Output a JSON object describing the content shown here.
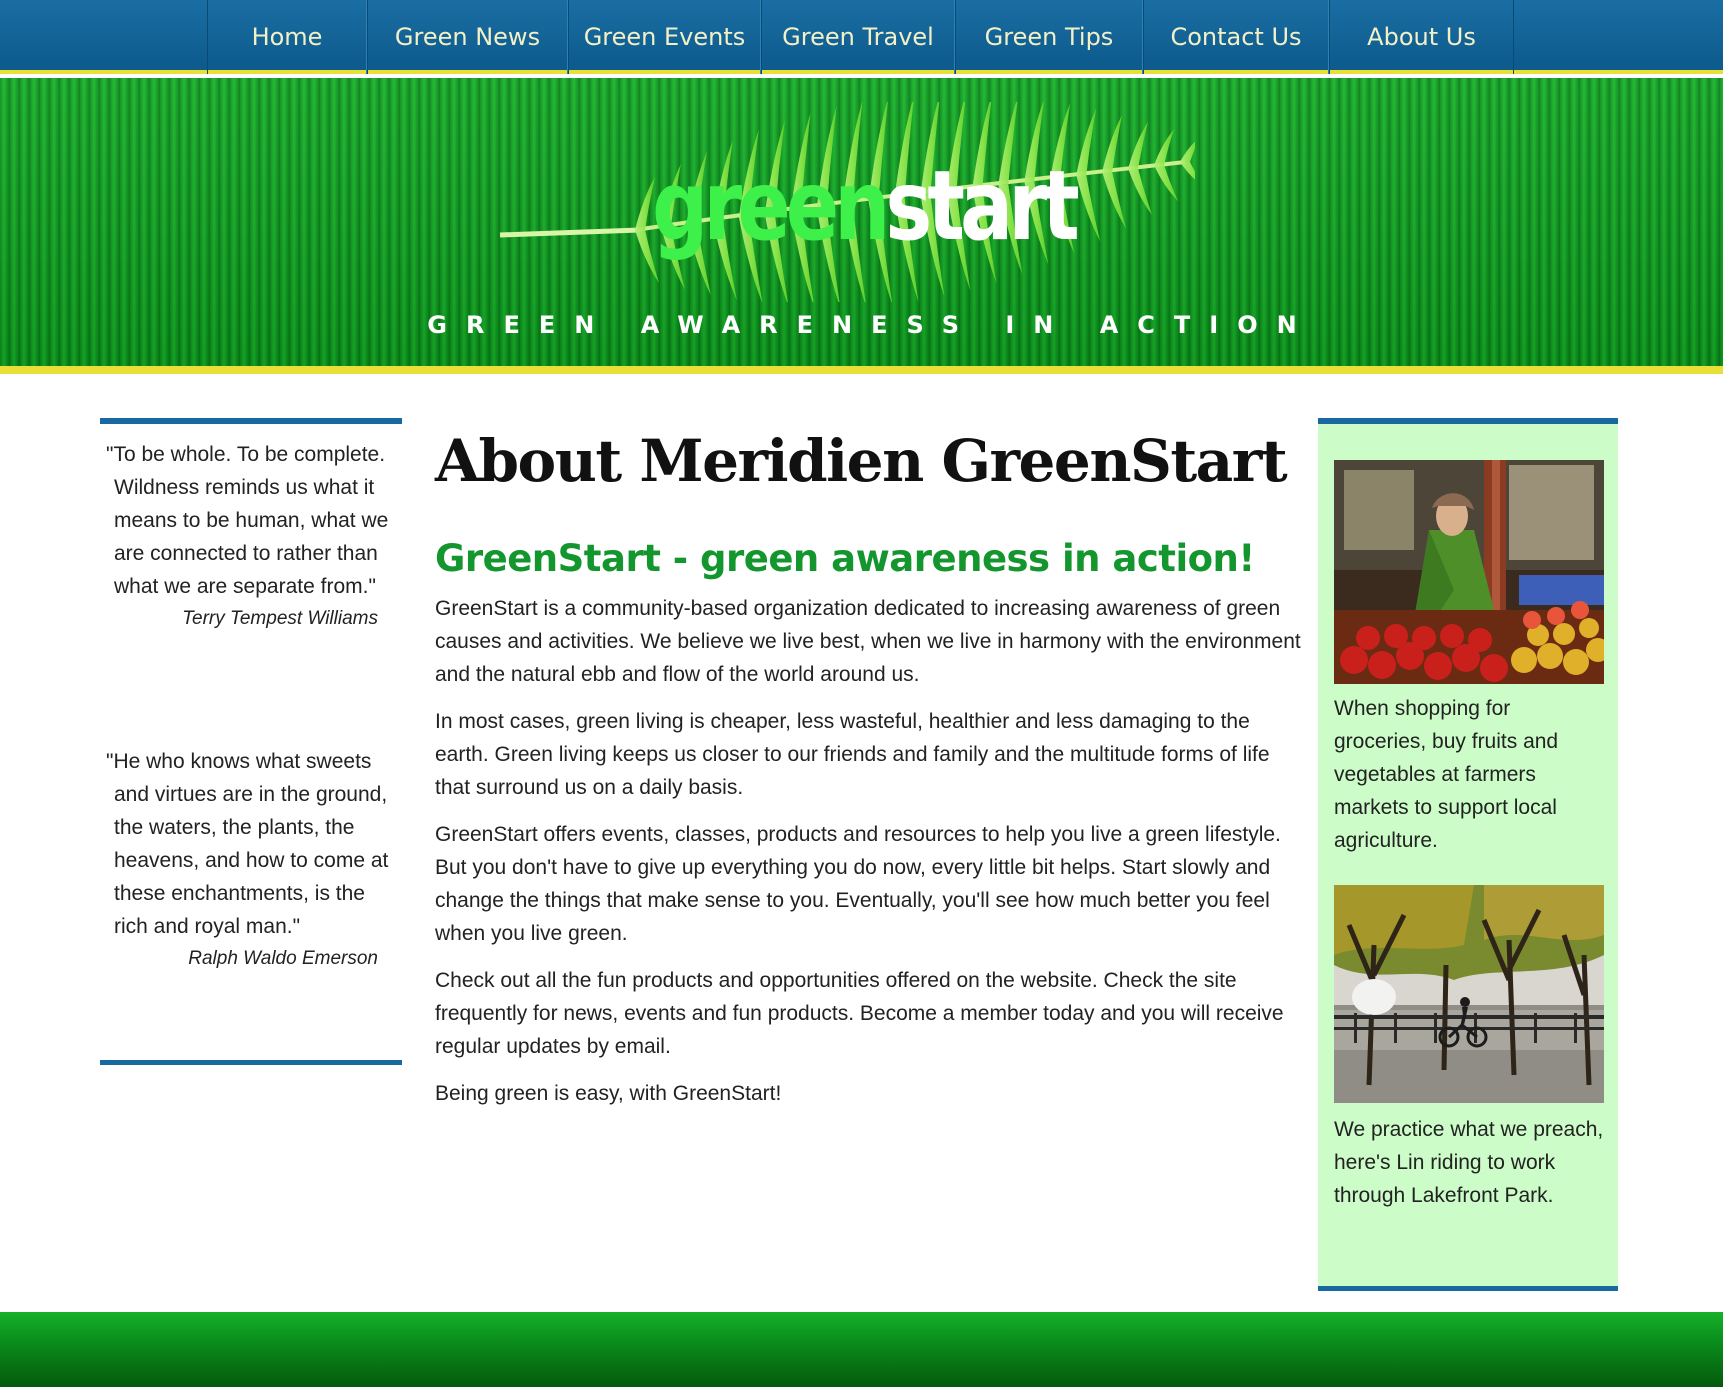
{
  "nav": {
    "items": [
      "Home",
      "Green News",
      "Green Events",
      "Green Travel",
      "Green Tips",
      "Contact Us",
      "About Us"
    ]
  },
  "banner": {
    "logo_part1": "green",
    "logo_part2": "start",
    "tagline": "GREEN AWARENESS IN ACTION"
  },
  "left": {
    "quotes": [
      {
        "text": "\"To be whole. To be complete. Wildness reminds us what it means to be human, what we are connected to rather than what we are separate from.\"",
        "author": "Terry Tempest Williams"
      },
      {
        "text": "\"He who knows what sweets and virtues are in the ground, the waters, the plants, the heavens, and how to come at these enchantments, is the rich and royal man.\"",
        "author": "Ralph Waldo Emerson"
      }
    ]
  },
  "main": {
    "title": "About Meridien GreenStart",
    "subtitle": "GreenStart - green awareness in action!",
    "paragraphs": [
      "GreenStart is a community-based organization dedicated to increasing awareness of green causes and activities. We believe we live best, when we live in harmony with the environment and the natural ebb and flow of the world around us.",
      "In most cases, green living is cheaper, less wasteful, healthier and less damaging to the earth. Green living keeps us closer to our friends and family and the multitude forms of life that surround us on a daily basis.",
      "GreenStart offers events, classes, products and resources to help you live a green lifestyle. But you don't have to give up everything you do now, every little bit helps. Start slowly and change the things that make sense to you. Eventually, you'll see how much better you feel when you live green.",
      "Check out all the fun products and opportunities offered on the website. Check the site frequently for news, events and fun products. Become a member today and you will receive regular updates by email.",
      "Being green is easy, with GreenStart!"
    ]
  },
  "right": {
    "captions": [
      "When shopping for groceries, buy fruits and vegetables at farmers markets to support local agriculture.",
      "We practice what we preach, here's Lin riding to work through Lakefront Park."
    ]
  },
  "colors": {
    "nav_blue": "#1a6ea3",
    "accent_yellow": "#e8e036",
    "banner_green": "#0a8f1c",
    "heading_green": "#14962e",
    "sidebar_bg": "#ccfdc8",
    "rule_blue": "#1769a0"
  }
}
